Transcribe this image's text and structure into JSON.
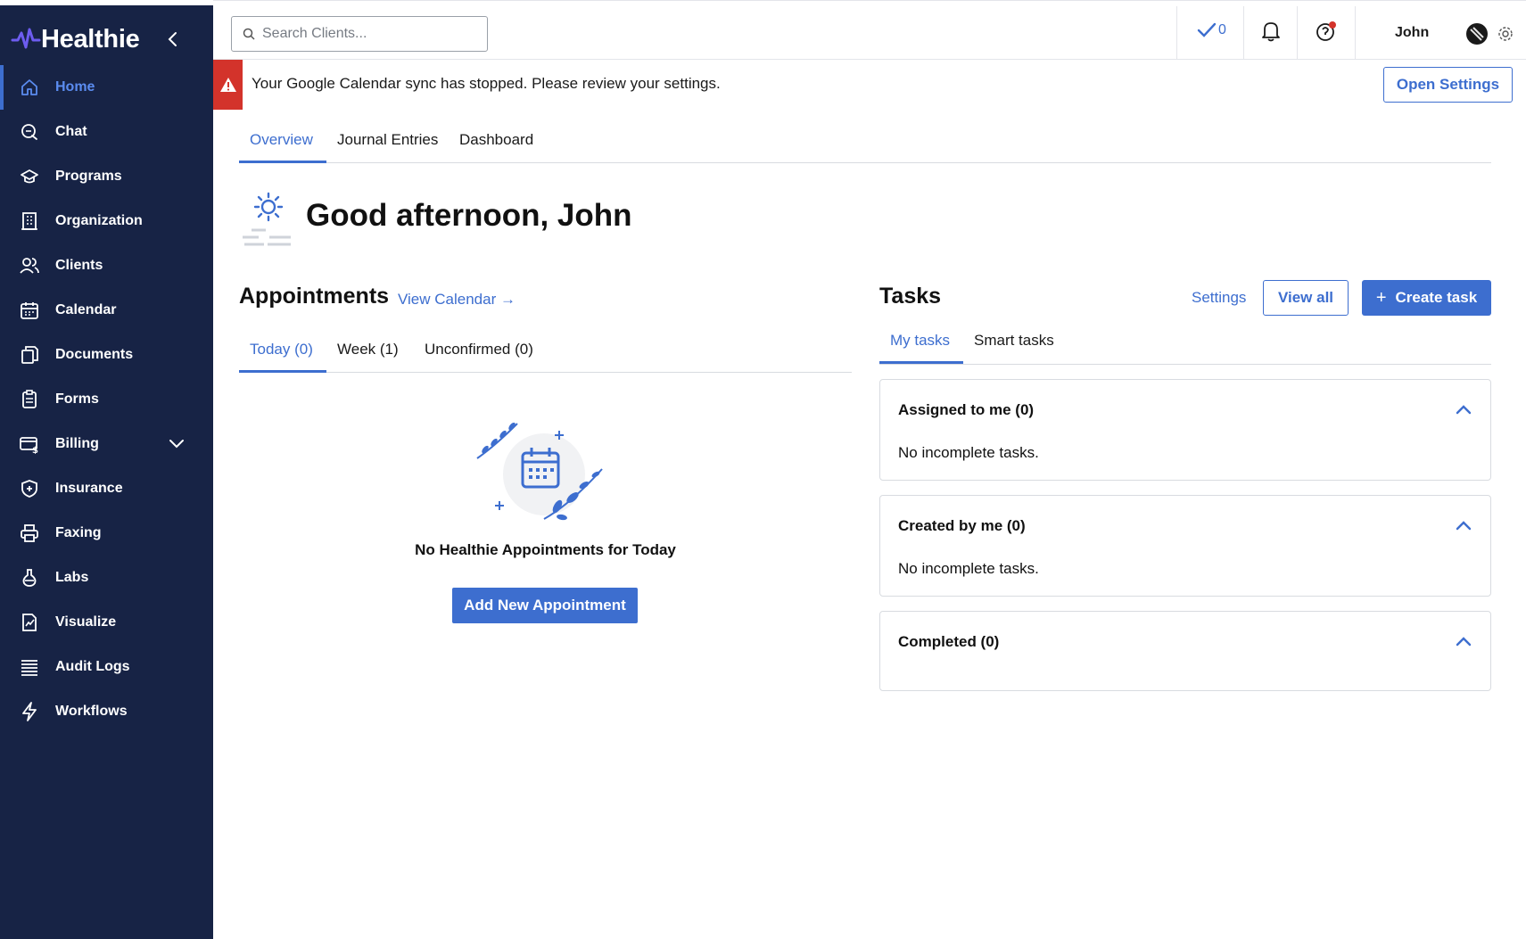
{
  "app": {
    "brand": "Healthie",
    "accent": "#3d6ecf",
    "sidebar_bg": "#172345",
    "alert_color": "#d3332b"
  },
  "sidebar": {
    "items": [
      {
        "label": "Home",
        "icon": "home-icon",
        "active": true
      },
      {
        "label": "Chat",
        "icon": "chat-icon"
      },
      {
        "label": "Programs",
        "icon": "graduation-cap-icon"
      },
      {
        "label": "Organization",
        "icon": "building-icon"
      },
      {
        "label": "Clients",
        "icon": "users-icon"
      },
      {
        "label": "Calendar",
        "icon": "calendar-icon"
      },
      {
        "label": "Documents",
        "icon": "documents-icon"
      },
      {
        "label": "Forms",
        "icon": "clipboard-icon"
      },
      {
        "label": "Billing",
        "icon": "billing-icon",
        "expandable": true
      },
      {
        "label": "Insurance",
        "icon": "shield-plus-icon"
      },
      {
        "label": "Faxing",
        "icon": "printer-icon"
      },
      {
        "label": "Labs",
        "icon": "flask-icon"
      },
      {
        "label": "Visualize",
        "icon": "chart-document-icon"
      },
      {
        "label": "Audit Logs",
        "icon": "list-lines-icon"
      },
      {
        "label": "Workflows",
        "icon": "lightning-icon"
      }
    ]
  },
  "topbar": {
    "search_placeholder": "Search Clients...",
    "tasks_count": "0",
    "user_name": "John"
  },
  "alert": {
    "message": "Your Google Calendar sync has stopped. Please review your settings.",
    "button": "Open Settings"
  },
  "main_tabs": [
    {
      "label": "Overview",
      "active": true
    },
    {
      "label": "Journal Entries"
    },
    {
      "label": "Dashboard"
    }
  ],
  "greeting": "Good afternoon, John",
  "appointments": {
    "title": "Appointments",
    "view_calendar": "View Calendar →",
    "tabs": [
      {
        "label": "Today (0)",
        "active": true
      },
      {
        "label": "Week (1)"
      },
      {
        "label": "Unconfirmed (0)"
      }
    ],
    "empty_text": "No Healthie Appointments for Today",
    "add_button": "Add New Appointment"
  },
  "tasks": {
    "title": "Tasks",
    "settings": "Settings",
    "view_all": "View all",
    "create": "Create task",
    "tabs": [
      {
        "label": "My tasks",
        "active": true
      },
      {
        "label": "Smart tasks"
      }
    ],
    "groups": [
      {
        "title": "Assigned to me (0)",
        "body": "No incomplete tasks."
      },
      {
        "title": "Created by me (0)",
        "body": "No incomplete tasks."
      },
      {
        "title": "Completed (0)",
        "body": ""
      }
    ]
  }
}
